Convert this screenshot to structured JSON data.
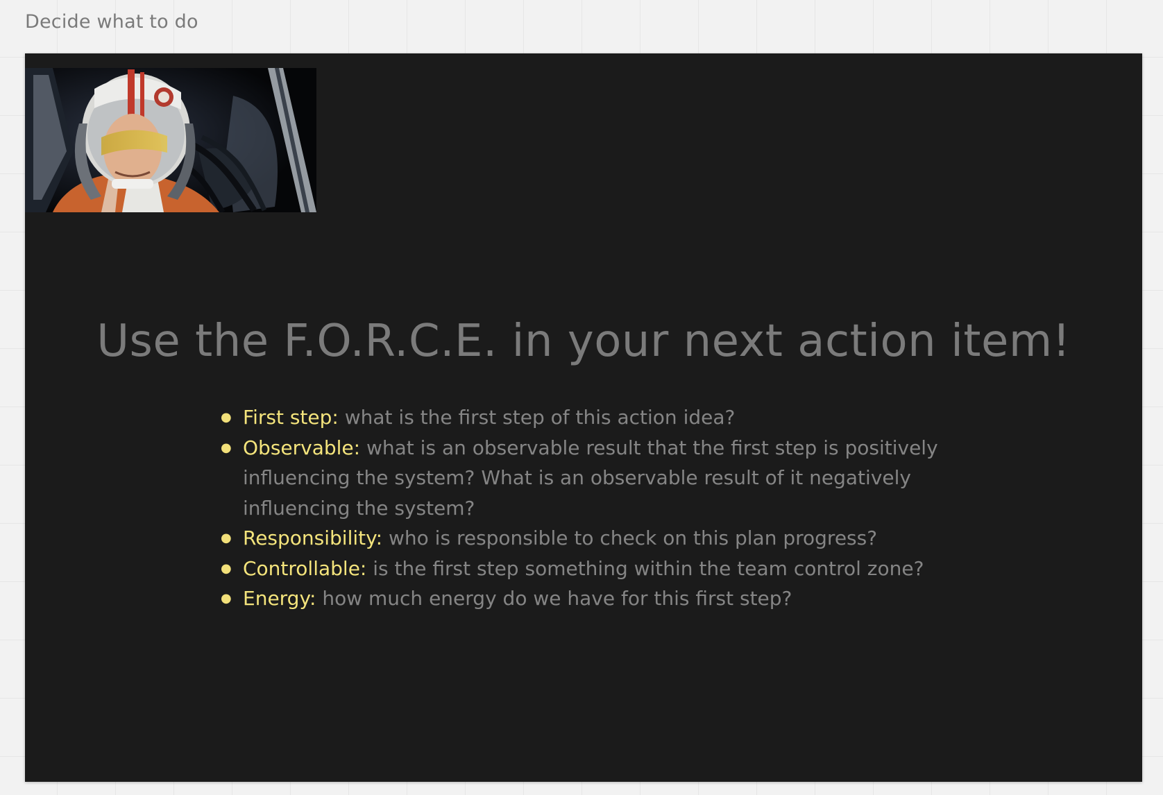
{
  "frame": {
    "title": "Decide what to do"
  },
  "slide": {
    "image_alt": "Pilot in helmet inside a starfighter cockpit",
    "heading": "Use the F.O.R.C.E. in your next action item!",
    "points": [
      {
        "term": "First step:",
        "text": " what is the first step of this action idea?"
      },
      {
        "term": "Observable:",
        "text": " what is an observable result that the first step is positively influencing the system? What is an observable result of it negatively influencing the system?"
      },
      {
        "term": "Responsibility:",
        "text": " who is responsible to check on this plan progress?"
      },
      {
        "term": "Controllable:",
        "text": " is the first step something within the team control zone?"
      },
      {
        "term": "Energy:",
        "text": " how much energy do we have for this first step?"
      }
    ]
  },
  "colors": {
    "canvas": "#f2f2f2",
    "slide_background": "#1b1b1b",
    "heading": "#7b7b7b",
    "body_text": "#858585",
    "highlight": "#f4e47c"
  }
}
